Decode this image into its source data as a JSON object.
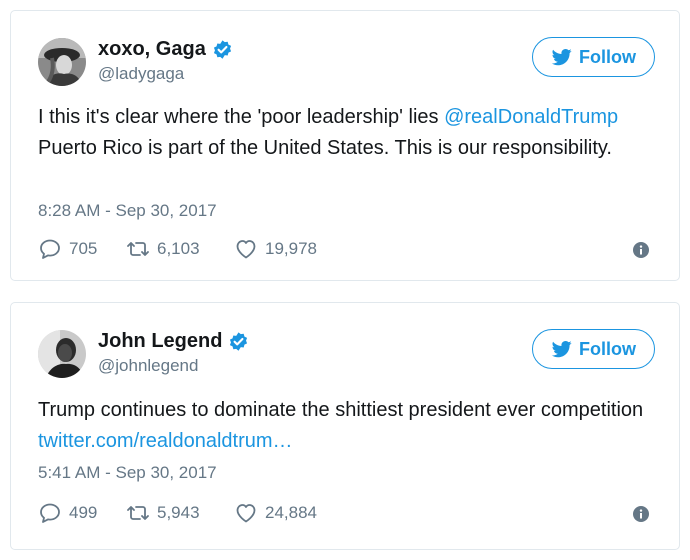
{
  "tweets": [
    {
      "display_name": "xoxo, Gaga",
      "handle": "@ladygaga",
      "follow_label": "Follow",
      "text_before": "I this it's clear where the 'poor leadership' lies ",
      "mention": "@realDonaldTrump",
      "text_after": " Puerto Rico is part of the United States. This is our responsibility.",
      "timestamp": "8:28 AM - Sep 30, 2017",
      "replies": "705",
      "retweets": "6,103",
      "likes": "19,978"
    },
    {
      "display_name": "John Legend",
      "handle": "@johnlegend",
      "follow_label": "Follow",
      "text_before": "Trump continues to dominate the shittiest president ever competition ",
      "link": "twitter.com/realdonaldtrum…",
      "timestamp": "5:41 AM - Sep 30, 2017",
      "replies": "499",
      "retweets": "5,943",
      "likes": "24,884"
    }
  ],
  "icons": {
    "verified": "verified-badge-icon",
    "follow": "twitter-bird-icon",
    "reply": "reply-bubble-icon",
    "retweet": "retweet-icon",
    "like": "heart-icon",
    "info": "info-icon"
  },
  "colors": {
    "accent": "#1b95e0",
    "text": "#14171a",
    "muted": "#657786",
    "border": "#e1e8ed"
  }
}
